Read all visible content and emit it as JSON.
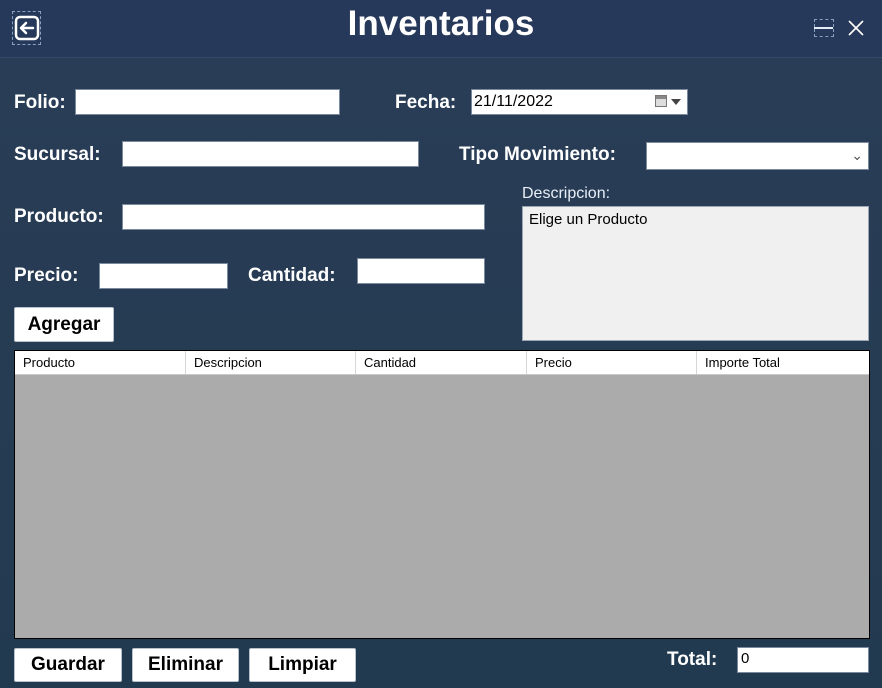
{
  "window": {
    "title": "Inventarios",
    "back_icon": "back-arrow-icon",
    "minimize_icon": "minimize-icon",
    "close_icon": "close-icon"
  },
  "form": {
    "folio": {
      "label": "Folio:",
      "value": ""
    },
    "fecha": {
      "label": "Fecha:",
      "value": "21/11/2022"
    },
    "sucursal": {
      "label": "Sucursal:",
      "value": ""
    },
    "tipo_movimiento": {
      "label": "Tipo Movimiento:",
      "value": ""
    },
    "producto": {
      "label": "Producto:",
      "value": ""
    },
    "precio": {
      "label": "Precio:",
      "value": ""
    },
    "cantidad": {
      "label": "Cantidad:",
      "value": ""
    },
    "descripcion": {
      "label": "Descripcion:",
      "value": "Elige un Producto"
    }
  },
  "buttons": {
    "agregar": "Agregar",
    "guardar": "Guardar",
    "eliminar": "Eliminar",
    "limpiar": "Limpiar"
  },
  "grid": {
    "columns": [
      "Producto",
      "Descripcion",
      "Cantidad",
      "Precio",
      "Importe Total"
    ],
    "rows": []
  },
  "total": {
    "label": "Total:",
    "value": "0"
  },
  "colors": {
    "background": "#263c53",
    "titlebar": "#27395a",
    "grid_background": "#ababab"
  }
}
